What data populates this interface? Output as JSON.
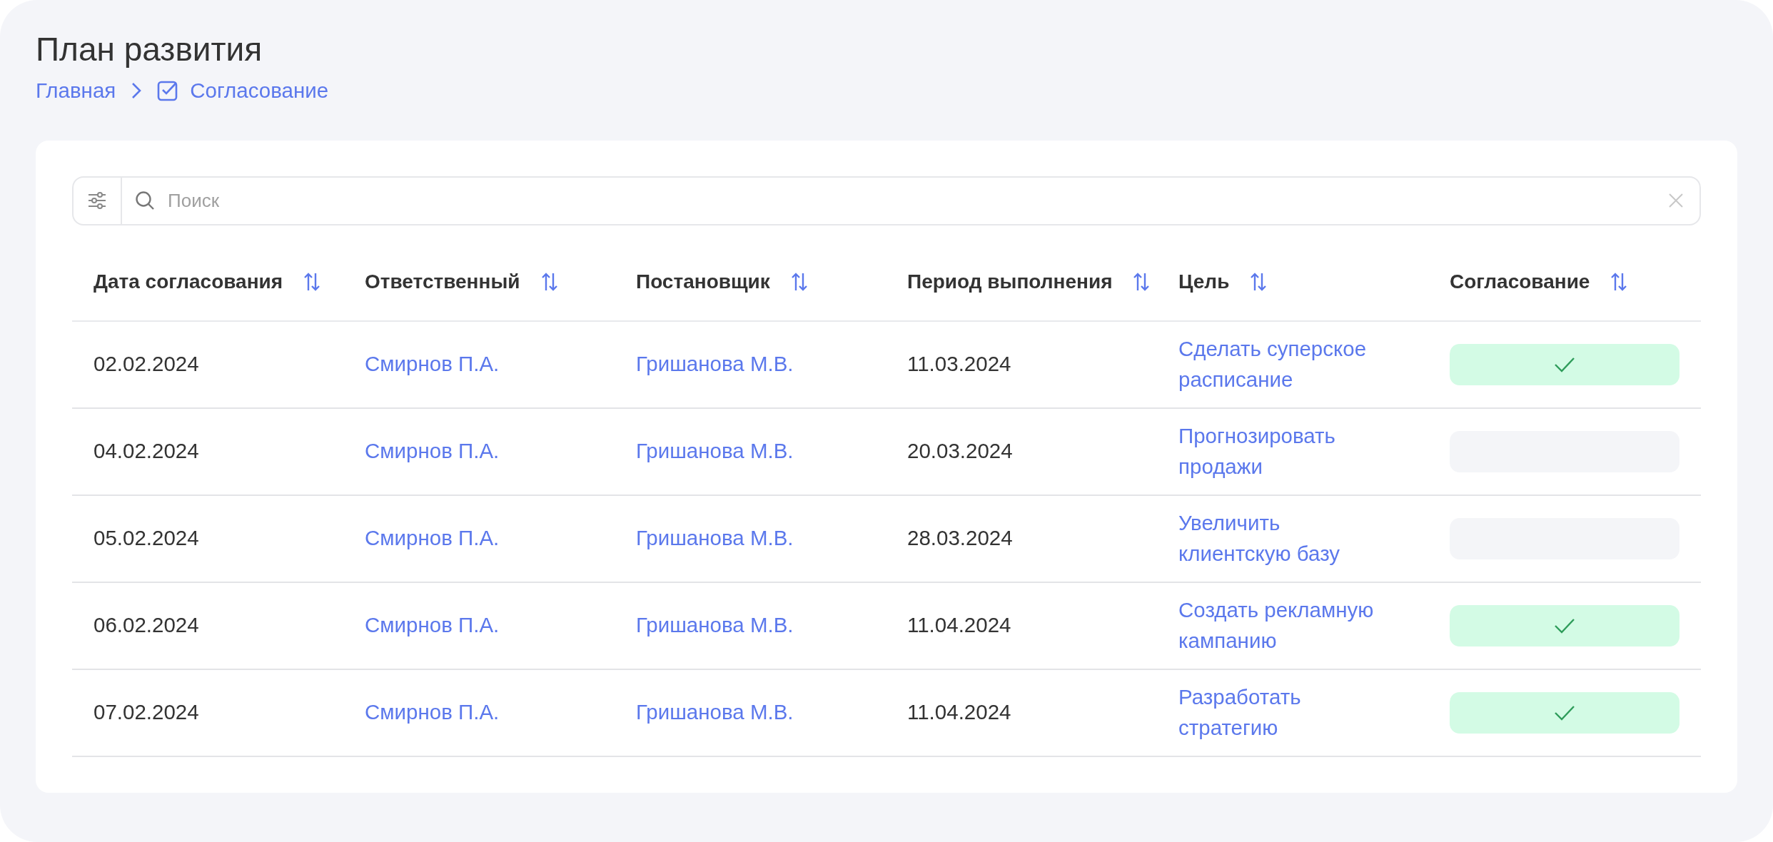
{
  "page": {
    "title": "План развития"
  },
  "breadcrumb": [
    {
      "label": "Главная",
      "kind": "link"
    },
    {
      "label": "Согласование",
      "kind": "current"
    }
  ],
  "search": {
    "placeholder": "Поиск"
  },
  "table": {
    "columns": [
      "Дата согласования",
      "Ответственный",
      "Постановщик",
      "Период выполнения",
      "Цель",
      "Согласование"
    ],
    "rows": [
      {
        "date": "02.02.2024",
        "responsible": "Смирнов П.А.",
        "assigner": "Гришанова М.В.",
        "period": "11.03.2024",
        "goal": "Сделать суперское расписание",
        "approved": true
      },
      {
        "date": "04.02.2024",
        "responsible": "Смирнов П.А.",
        "assigner": "Гришанова М.В.",
        "period": "20.03.2024",
        "goal": "Прогнозировать продажи",
        "approved": false
      },
      {
        "date": "05.02.2024",
        "responsible": "Смирнов П.А.",
        "assigner": "Гришанова М.В.",
        "period": "28.03.2024",
        "goal": "Увеличить клиентскую базу",
        "approved": false
      },
      {
        "date": "06.02.2024",
        "responsible": "Смирнов П.А.",
        "assigner": "Гришанова М.В.",
        "period": "11.04.2024",
        "goal": "Создать рекламную кампанию",
        "approved": true
      },
      {
        "date": "07.02.2024",
        "responsible": "Смирнов П.А.",
        "assigner": "Гришанова М.В.",
        "period": "11.04.2024",
        "goal": "Разработать стратегию",
        "approved": true
      }
    ]
  }
}
